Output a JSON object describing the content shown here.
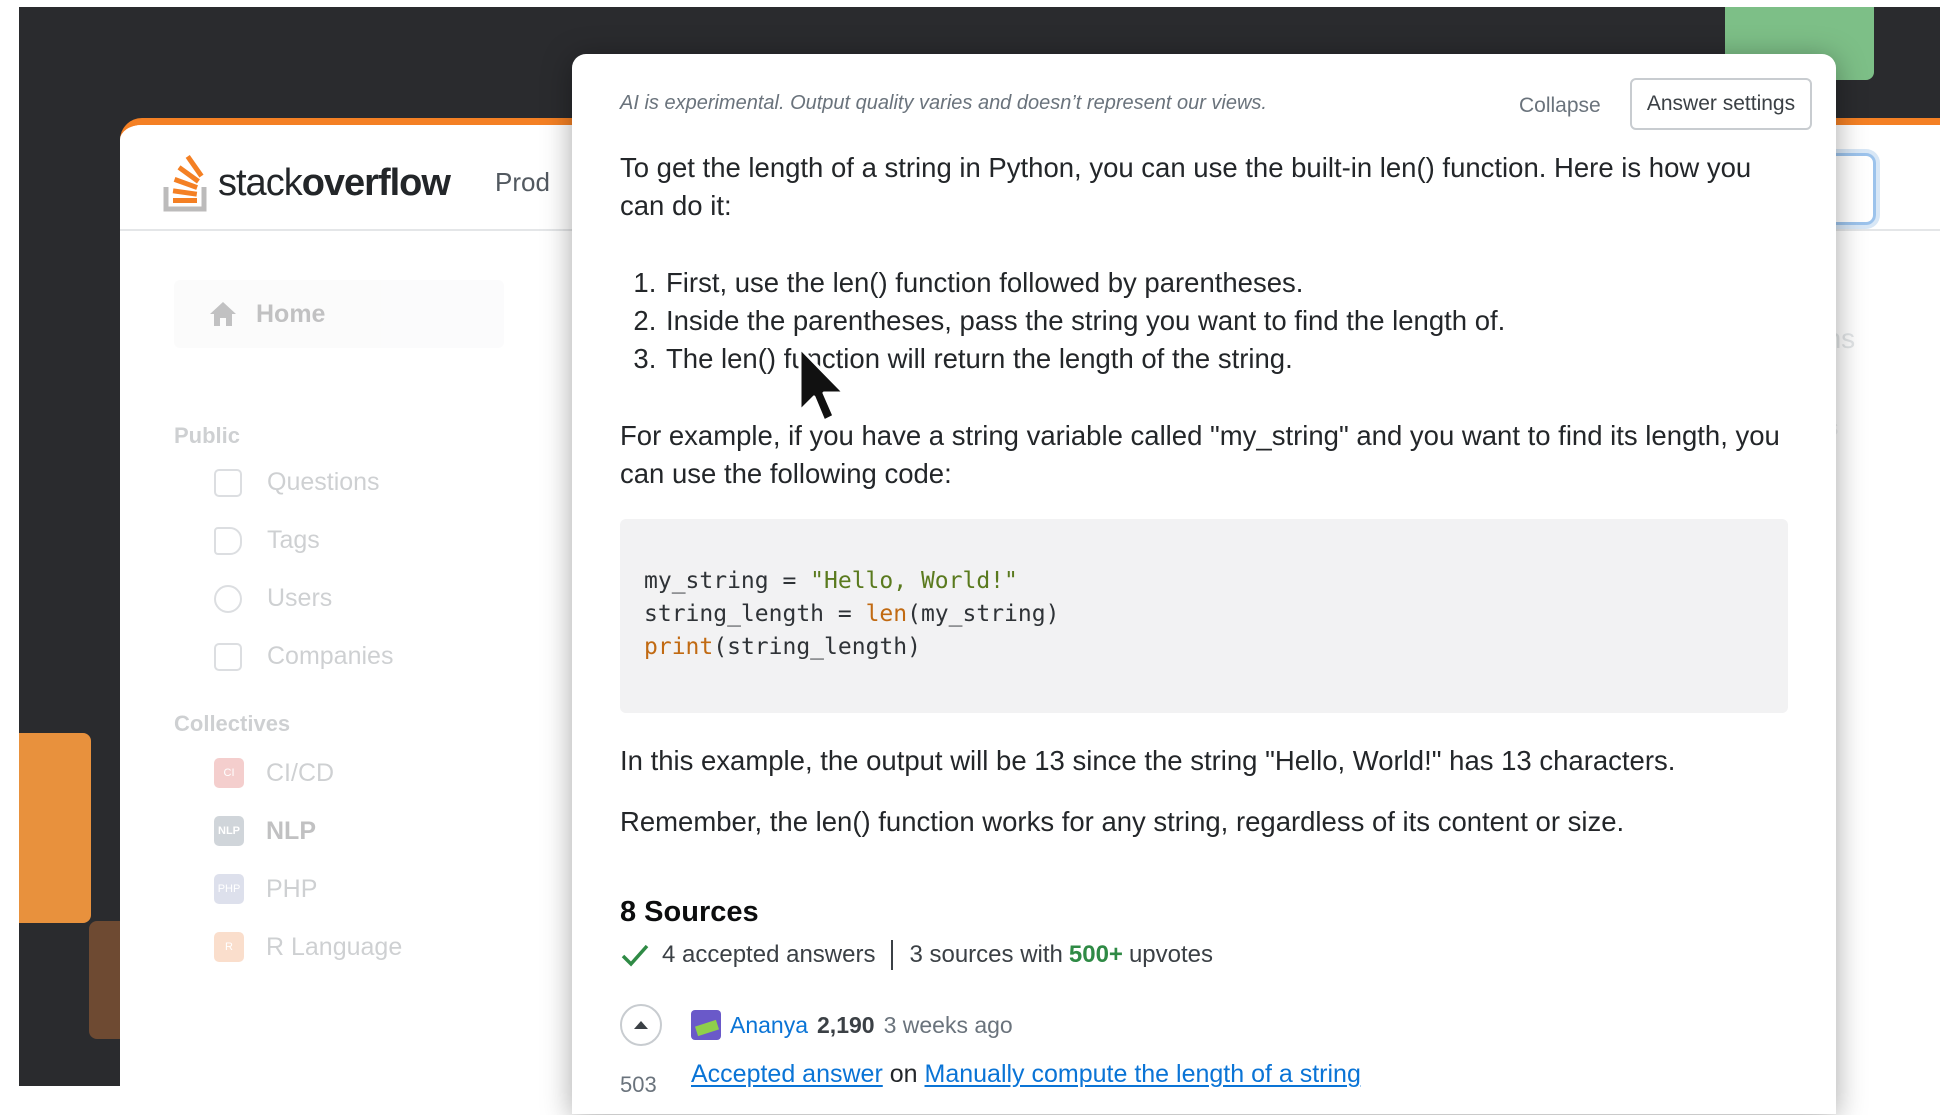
{
  "background_page": {
    "logo": {
      "word1": "stack",
      "word2": "overflow"
    },
    "products_label": "Prod",
    "sidebar": {
      "home": "Home",
      "public_heading": "Public",
      "public_items": [
        "Questions",
        "Tags",
        "Users",
        "Companies"
      ],
      "collectives_heading": "Collectives",
      "collectives": [
        {
          "label": "CI/CD",
          "badge": "CI"
        },
        {
          "label": "NLP",
          "badge": "NLP"
        },
        {
          "label": "PHP",
          "badge": "PHP"
        },
        {
          "label": "R Language",
          "badge": "R"
        }
      ]
    },
    "right_ghost_text": "ons",
    "right_ghost_text2": "rs"
  },
  "panel": {
    "disclaimer": "AI is experimental. Output quality varies and doesn’t represent our views.",
    "collapse_label": "Collapse",
    "settings_label": "Answer settings",
    "intro": "To get the length of a string in Python, you can use the built-in len() function. Here is how you can do it:",
    "steps": [
      "First, use the len() function followed by parentheses.",
      "Inside the parentheses, pass the string you want to find the length of.",
      "The len() function will return the length of the string."
    ],
    "example_text": "For example, if you have a string variable called \"my_string\" and you want to find its length, you can use the following code:",
    "code": {
      "line1_var": "my_string = ",
      "line1_str": "\"Hello, World!\"",
      "line2_var": "string_length = ",
      "line2_fn": "len",
      "line2_rest": "(my_string)",
      "line3_fn": "print",
      "line3_rest": "(string_length)"
    },
    "result_text": "In this example, the output will be 13 since the string \"Hello, World!\" has 13 characters.",
    "reminder_text": "Remember, the len() function works for any string, regardless of its content or size.",
    "sources": {
      "title": "8 Sources",
      "accepted": "4 accepted answers",
      "upvotes_prefix": "3 sources with",
      "upvotes_highlight": "500+",
      "upvotes_suffix": "upvotes",
      "first": {
        "user": "Ananya",
        "reputation": "2,190",
        "when": "3 weeks ago",
        "link1": "Accepted answer",
        "connector": "on",
        "link2": "Manually compute the length of a string",
        "votes": "503"
      }
    }
  },
  "colors": {
    "accent_orange": "#f48024",
    "link_blue": "#0a74d6",
    "accepted_green": "#2f8a45"
  }
}
